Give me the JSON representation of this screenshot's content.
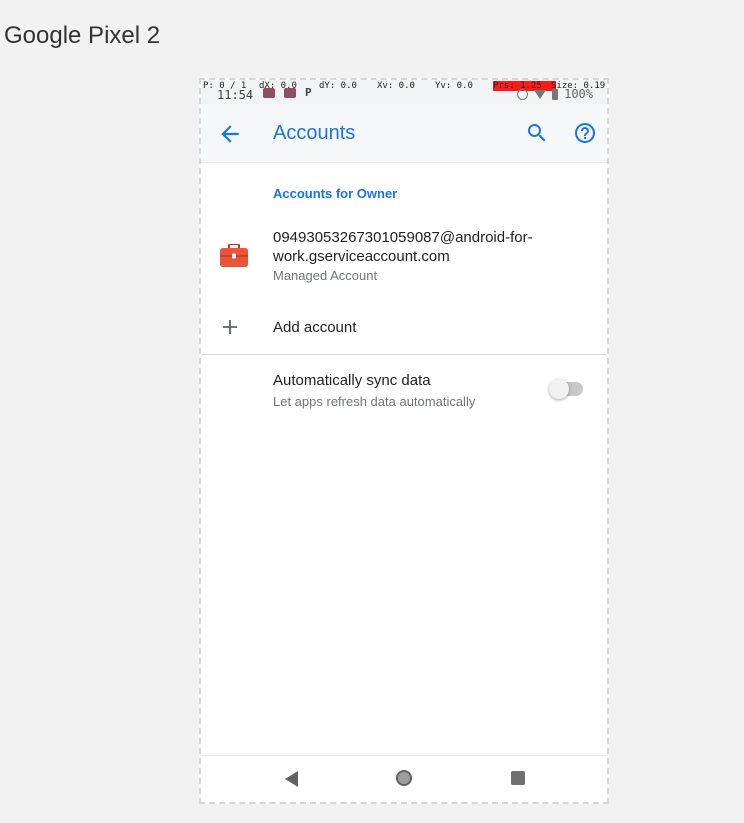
{
  "device_label": "Google Pixel 2",
  "status_bar": {
    "time": "11:54",
    "p_debug": "P: 0 / 1",
    "dx": "dX: 0.0",
    "dy": "dY: 0.0",
    "xv": "Xv: 0.0",
    "yv": "Yv: 0.0",
    "prs": "Prs: 1.25",
    "size": "Size: 0.19",
    "battery": "100%",
    "p_icon": "P"
  },
  "app_bar": {
    "title": "Accounts",
    "back_icon": "arrow-back-icon",
    "search_icon": "search-icon",
    "help_icon": "help-icon",
    "accent_color": "#1a73e8"
  },
  "section": {
    "title": "Accounts for Owner"
  },
  "account": {
    "email": "09493053267301059087@android-for-work.gserviceaccount.com",
    "type": "Managed Account",
    "icon": "briefcase-icon",
    "icon_color": "#e8553b"
  },
  "add_account": {
    "label": "Add account",
    "icon": "plus-icon"
  },
  "sync": {
    "title": "Automatically sync data",
    "subtitle": "Let apps refresh data automatically",
    "enabled": false
  },
  "nav_bar": {
    "back": "nav-back-icon",
    "home": "nav-home-icon",
    "recents": "nav-recents-icon"
  }
}
